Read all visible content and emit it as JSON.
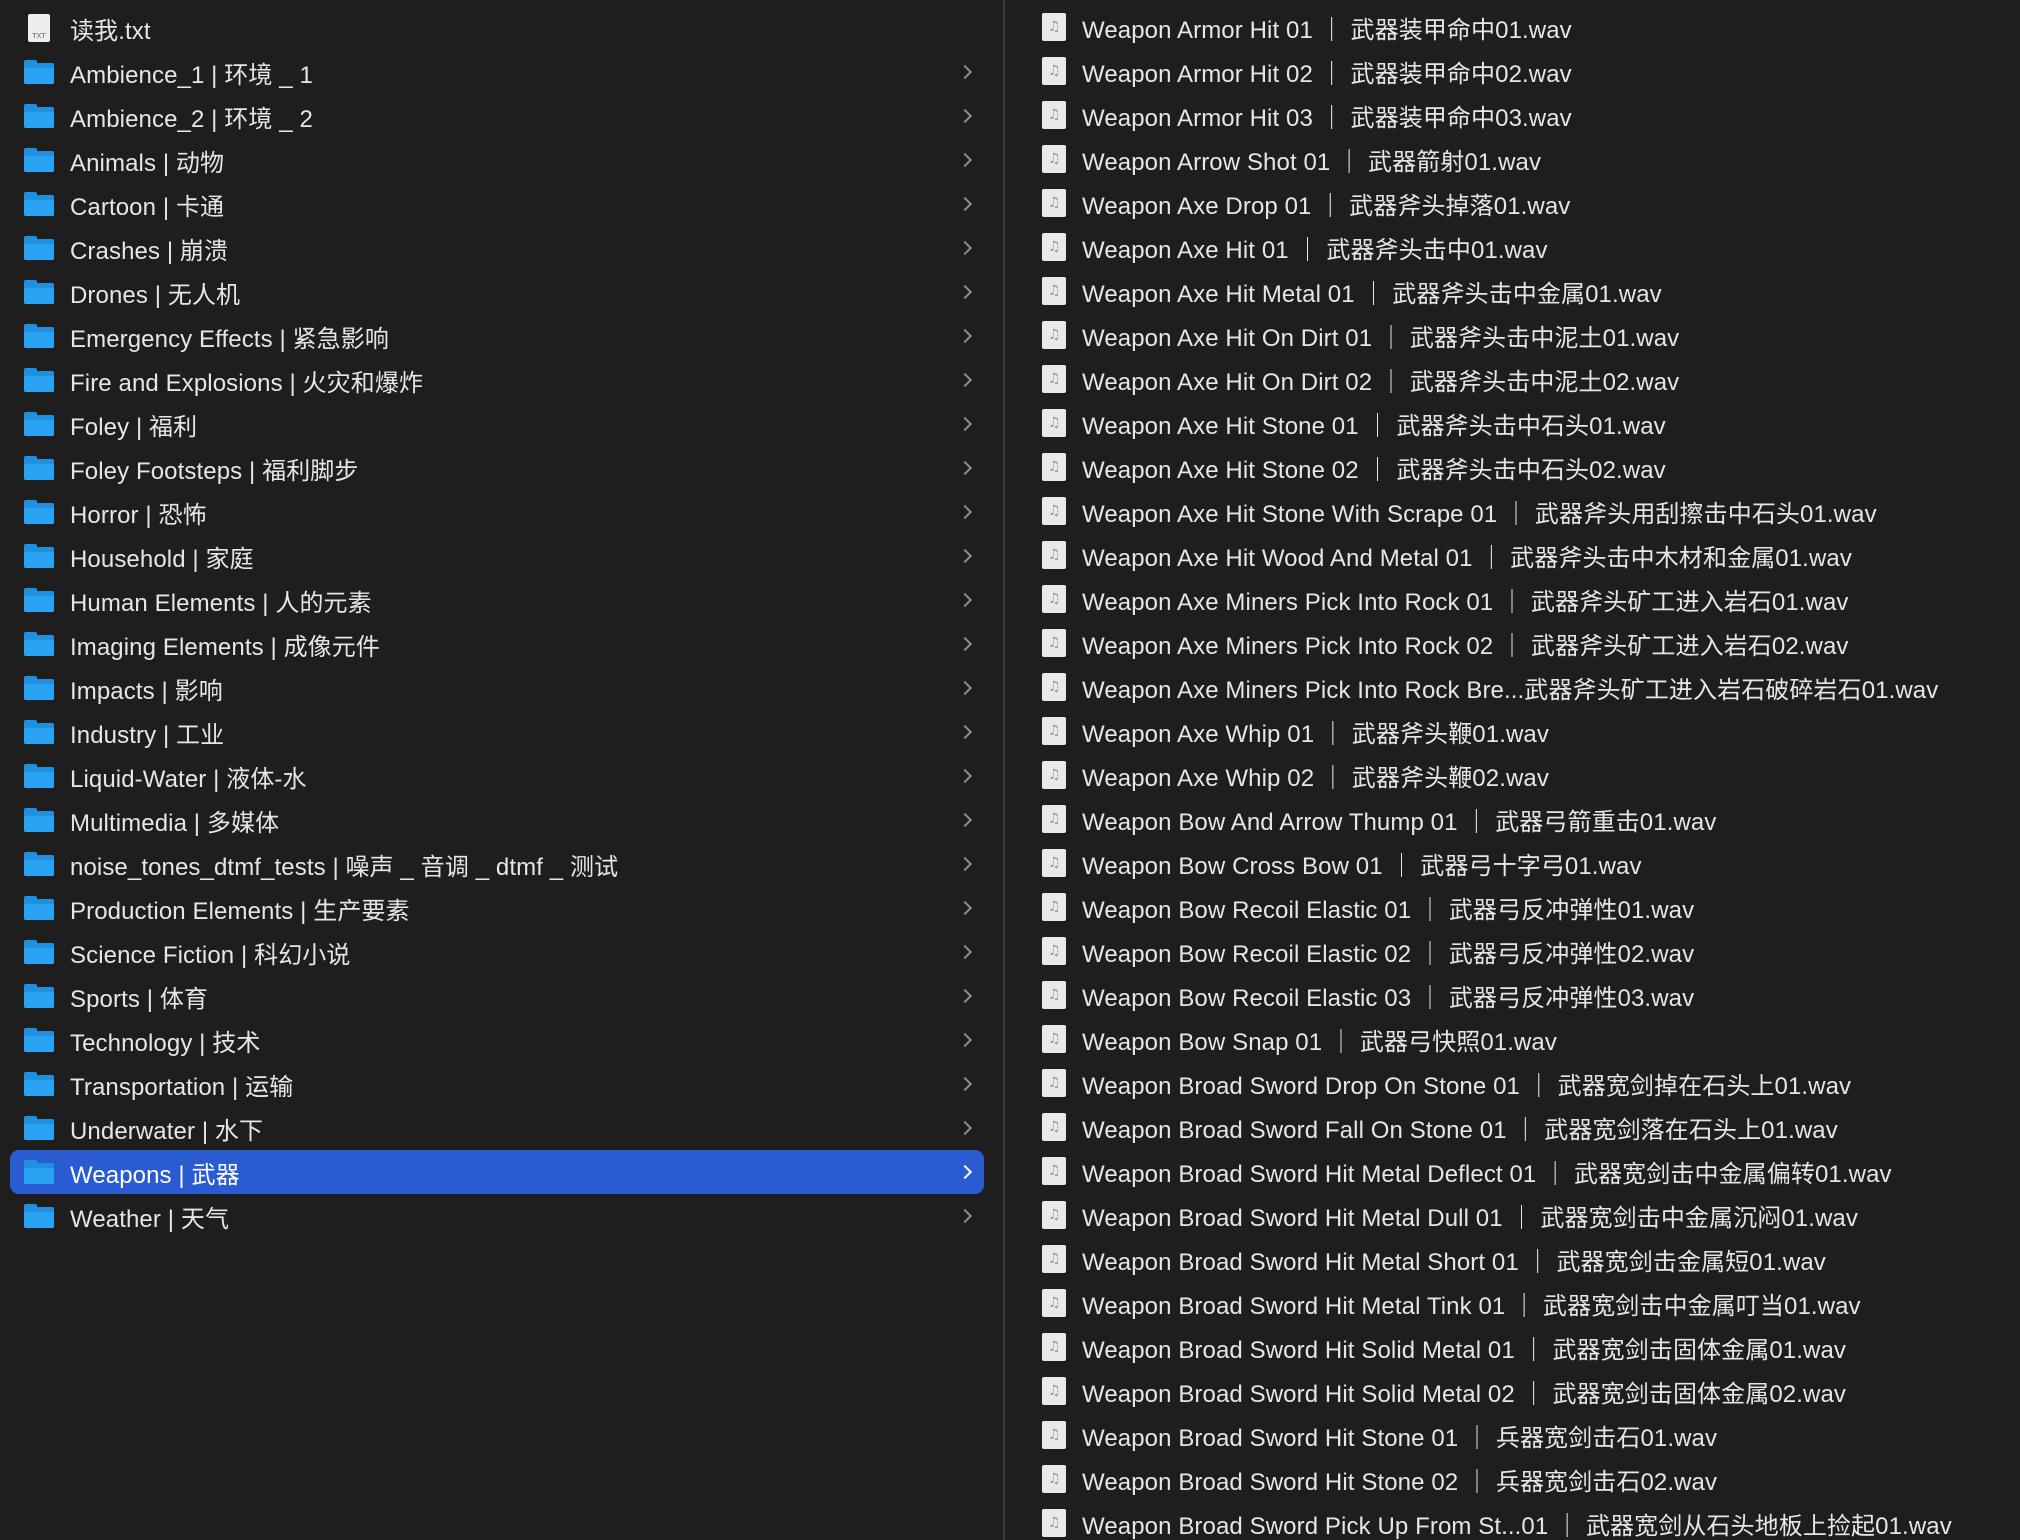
{
  "left_column": {
    "items": [
      {
        "label": "读我.txt",
        "kind": "file",
        "icon": "text-file-icon",
        "ext": "TXT"
      },
      {
        "label": "Ambience_1 | 环境 _ 1",
        "kind": "folder",
        "icon": "folder-icon"
      },
      {
        "label": "Ambience_2 | 环境 _ 2",
        "kind": "folder",
        "icon": "folder-icon"
      },
      {
        "label": "Animals | 动物",
        "kind": "folder",
        "icon": "folder-icon"
      },
      {
        "label": "Cartoon | 卡通",
        "kind": "folder",
        "icon": "folder-icon"
      },
      {
        "label": "Crashes | 崩溃",
        "kind": "folder",
        "icon": "folder-icon"
      },
      {
        "label": "Drones | 无人机",
        "kind": "folder",
        "icon": "folder-icon"
      },
      {
        "label": "Emergency Effects | 紧急影响",
        "kind": "folder",
        "icon": "folder-icon"
      },
      {
        "label": "Fire and Explosions | 火灾和爆炸",
        "kind": "folder",
        "icon": "folder-icon"
      },
      {
        "label": "Foley | 福利",
        "kind": "folder",
        "icon": "folder-icon"
      },
      {
        "label": "Foley Footsteps | 福利脚步",
        "kind": "folder",
        "icon": "folder-icon"
      },
      {
        "label": "Horror | 恐怖",
        "kind": "folder",
        "icon": "folder-icon"
      },
      {
        "label": "Household | 家庭",
        "kind": "folder",
        "icon": "folder-icon"
      },
      {
        "label": "Human Elements | 人的元素",
        "kind": "folder",
        "icon": "folder-icon"
      },
      {
        "label": "Imaging Elements | 成像元件",
        "kind": "folder",
        "icon": "folder-icon"
      },
      {
        "label": "Impacts | 影响",
        "kind": "folder",
        "icon": "folder-icon"
      },
      {
        "label": "Industry | 工业",
        "kind": "folder",
        "icon": "folder-icon"
      },
      {
        "label": "Liquid-Water | 液体-水",
        "kind": "folder",
        "icon": "folder-icon"
      },
      {
        "label": "Multimedia | 多媒体",
        "kind": "folder",
        "icon": "folder-icon"
      },
      {
        "label": "noise_tones_dtmf_tests | 噪声 _ 音调 _ dtmf _ 测试",
        "kind": "folder",
        "icon": "folder-icon"
      },
      {
        "label": "Production Elements | 生产要素",
        "kind": "folder",
        "icon": "folder-icon"
      },
      {
        "label": "Science Fiction | 科幻小说",
        "kind": "folder",
        "icon": "folder-icon"
      },
      {
        "label": "Sports | 体育",
        "kind": "folder",
        "icon": "folder-icon"
      },
      {
        "label": "Technology | 技术",
        "kind": "folder",
        "icon": "folder-icon"
      },
      {
        "label": "Transportation | 运输",
        "kind": "folder",
        "icon": "folder-icon"
      },
      {
        "label": "Underwater | 水下",
        "kind": "folder",
        "icon": "folder-icon"
      },
      {
        "label": "Weapons | 武器",
        "kind": "folder",
        "icon": "folder-icon",
        "selected": true
      },
      {
        "label": "Weather | 天气",
        "kind": "folder",
        "icon": "folder-icon"
      }
    ]
  },
  "right_column": {
    "icon": "audio-file-icon",
    "files": [
      "Weapon Armor Hit 01 ｜ 武器装甲命中01.wav",
      "Weapon Armor Hit 02 ｜ 武器装甲命中02.wav",
      "Weapon Armor Hit 03 ｜ 武器装甲命中03.wav",
      "Weapon Arrow Shot 01 ｜ 武器箭射01.wav",
      "Weapon Axe Drop 01 ｜ 武器斧头掉落01.wav",
      "Weapon Axe Hit 01 ｜ 武器斧头击中01.wav",
      "Weapon Axe Hit Metal 01 ｜ 武器斧头击中金属01.wav",
      "Weapon Axe Hit On Dirt 01 ｜ 武器斧头击中泥土01.wav",
      "Weapon Axe Hit On Dirt 02 ｜ 武器斧头击中泥土02.wav",
      "Weapon Axe Hit Stone 01 ｜ 武器斧头击中石头01.wav",
      "Weapon Axe Hit Stone 02 ｜ 武器斧头击中石头02.wav",
      "Weapon Axe Hit Stone With Scrape 01 ｜ 武器斧头用刮擦击中石头01.wav",
      "Weapon Axe Hit Wood And Metal 01 ｜ 武器斧头击中木材和金属01.wav",
      "Weapon Axe Miners Pick Into Rock 01 ｜ 武器斧头矿工进入岩石01.wav",
      "Weapon Axe Miners Pick Into Rock 02 ｜ 武器斧头矿工进入岩石02.wav",
      "Weapon Axe Miners Pick Into Rock Bre...武器斧头矿工进入岩石破碎岩石01.wav",
      "Weapon Axe Whip 01 ｜ 武器斧头鞭01.wav",
      "Weapon Axe Whip 02 ｜ 武器斧头鞭02.wav",
      "Weapon Bow And Arrow Thump 01 ｜ 武器弓箭重击01.wav",
      "Weapon Bow Cross Bow 01 ｜ 武器弓十字弓01.wav",
      "Weapon Bow Recoil Elastic 01 ｜ 武器弓反冲弹性01.wav",
      "Weapon Bow Recoil Elastic 02 ｜ 武器弓反冲弹性02.wav",
      "Weapon Bow Recoil Elastic 03 ｜ 武器弓反冲弹性03.wav",
      "Weapon Bow Snap 01 ｜ 武器弓快照01.wav",
      "Weapon Broad Sword Drop On Stone 01 ｜ 武器宽剑掉在石头上01.wav",
      "Weapon Broad Sword Fall On Stone 01 ｜ 武器宽剑落在石头上01.wav",
      "Weapon Broad Sword Hit Metal Deflect 01 ｜ 武器宽剑击中金属偏转01.wav",
      "Weapon Broad Sword Hit Metal Dull 01 ｜ 武器宽剑击中金属沉闷01.wav",
      "Weapon Broad Sword Hit Metal Short 01 ｜ 武器宽剑击金属短01.wav",
      "Weapon Broad Sword Hit Metal Tink 01 ｜ 武器宽剑击中金属叮当01.wav",
      "Weapon Broad Sword Hit Solid Metal 01 ｜ 武器宽剑击固体金属01.wav",
      "Weapon Broad Sword Hit Solid Metal 02 ｜ 武器宽剑击固体金属02.wav",
      "Weapon Broad Sword Hit Stone 01 ｜ 兵器宽剑击石01.wav",
      "Weapon Broad Sword Hit Stone 02 ｜ 兵器宽剑击石02.wav",
      "Weapon Broad Sword Pick Up From St...01 ｜ 武器宽剑从石头地板上捡起01.wav"
    ]
  },
  "colors": {
    "background": "#1e1e1e",
    "selection": "#2a5bd0",
    "folder_blue": "#2aa3f5",
    "text": "#e6e6e6"
  }
}
